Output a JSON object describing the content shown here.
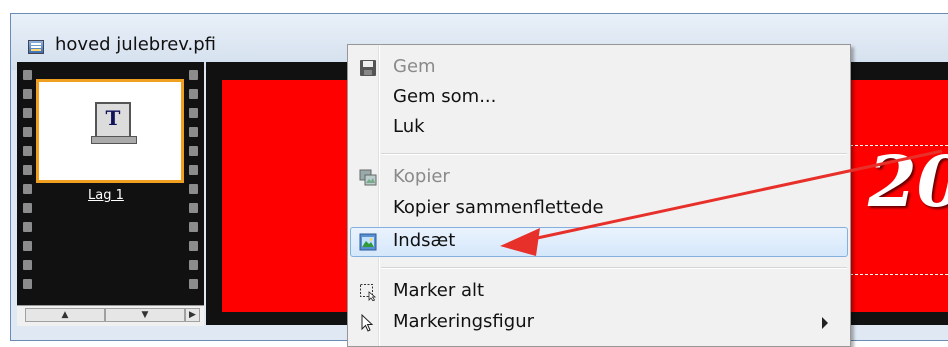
{
  "window": {
    "title": "hoved julebrev.pfi",
    "title_icon": "image-file-icon"
  },
  "layers_panel": {
    "layers": [
      {
        "label": "Lag 1",
        "icon": "text-layer-icon",
        "glyph": "T",
        "selected": true
      }
    ],
    "scroll_buttons": [
      "▲",
      "▼",
      "▶"
    ]
  },
  "canvas": {
    "background_color": "#ff0000",
    "visible_text": "20"
  },
  "context_menu": {
    "items": [
      {
        "label": "Gem",
        "icon": "floppy-disk-icon",
        "disabled": true
      },
      {
        "label": "Gem som...",
        "icon": null,
        "disabled": false
      },
      {
        "label": "Luk",
        "icon": null,
        "disabled": false
      },
      {
        "separator": true
      },
      {
        "label": "Kopier",
        "icon": "copy-image-icon",
        "disabled": true
      },
      {
        "label": "Kopier sammenflettede",
        "icon": null,
        "disabled": false
      },
      {
        "label": "Indsæt",
        "icon": "paste-image-icon",
        "disabled": false,
        "highlighted": true
      },
      {
        "separator": true
      },
      {
        "label": "Marker alt",
        "icon": "select-all-icon",
        "disabled": false
      },
      {
        "label": "Markeringsfigur",
        "icon": "selection-shape-cursor-icon",
        "disabled": false,
        "has_submenu": true
      }
    ]
  },
  "annotation": {
    "arrow_color": "#e8302a"
  }
}
